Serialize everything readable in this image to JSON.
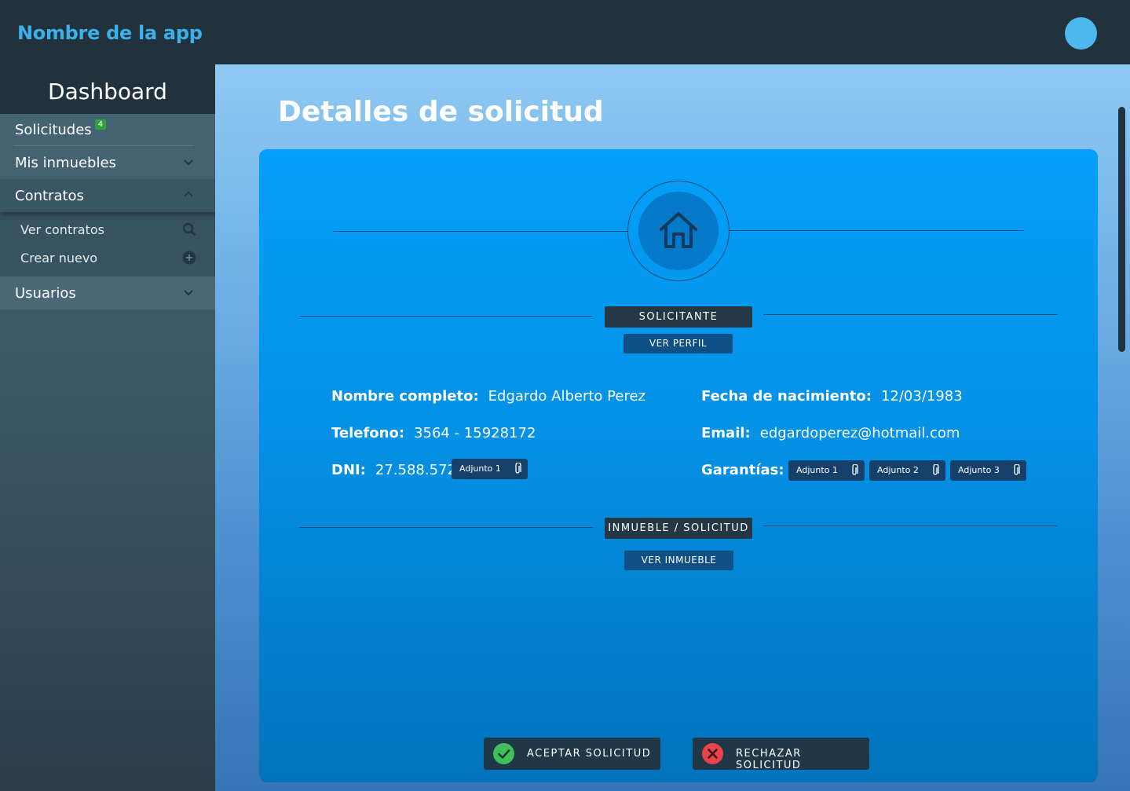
{
  "header": {
    "app_name": "Nombre de la app"
  },
  "sidebar": {
    "title": "Dashboard",
    "items": [
      {
        "label": "Solicitudes",
        "badge": "4"
      },
      {
        "label": "Mis inmuebles"
      },
      {
        "label": "Contratos",
        "subitems": [
          {
            "label": "Ver contratos",
            "icon": "search-icon"
          },
          {
            "label": "Crear nuevo",
            "icon": "plus-circle-icon"
          }
        ]
      },
      {
        "label": "Usuarios"
      }
    ]
  },
  "main": {
    "title": "Detalles de solicitud",
    "section_applicant": {
      "label": "SOLICITANTE",
      "button": "VER PERFIL"
    },
    "fields": {
      "nombre": {
        "label": "Nombre completo:",
        "value": "Edgardo Alberto Perez"
      },
      "telefono": {
        "label": "Telefono:",
        "value": "3564 - 15928172"
      },
      "dni": {
        "label": "DNI:",
        "value": "27.588.572",
        "attachment": "Adjunto 1"
      },
      "nacimiento": {
        "label": "Fecha de nacimiento:",
        "value": "12/03/1983"
      },
      "email": {
        "label": "Email:",
        "value": "edgardoperez@hotmail.com"
      },
      "garantias": {
        "label": "Garantías:",
        "attachments": [
          "Adjunto 1",
          "Adjunto 2",
          "Adjunto 3"
        ]
      }
    },
    "section_property": {
      "label": "INMUEBLE / SOLICITUD",
      "button": "VER INMUEBLE"
    },
    "actions": {
      "accept": "ACEPTAR SOLICITUD",
      "reject": "RECHAZAR SOLICITUD"
    }
  },
  "colors": {
    "accent": "#3cb0e8",
    "accept": "#3fbf5a",
    "reject": "#e8434b",
    "badge": "#2fa33a"
  }
}
